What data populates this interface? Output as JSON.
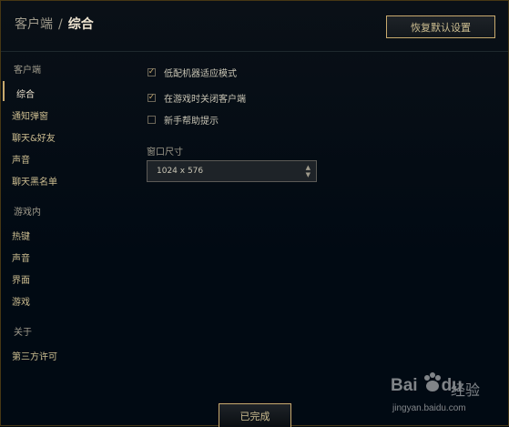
{
  "header": {
    "breadcrumb_parent": "客户端",
    "breadcrumb_sep": "/",
    "breadcrumb_current": "综合",
    "restore_button": "恢复默认设置"
  },
  "sidebar": {
    "categories": [
      {
        "label": "客户端",
        "items": [
          "综合",
          "通知弹窗",
          "聊天&好友",
          "声音",
          "聊天黑名单"
        ]
      },
      {
        "label": "游戏内",
        "items": [
          "热键",
          "声音",
          "界面",
          "游戏"
        ]
      },
      {
        "label": "关于",
        "items": [
          "第三方许可"
        ]
      }
    ],
    "active_item": "综合"
  },
  "options": [
    {
      "label": "低配机器适应模式",
      "checked": true
    },
    {
      "label": "在游戏时关闭客户端",
      "checked": true
    },
    {
      "label": "新手帮助提示",
      "checked": false
    }
  ],
  "window_size": {
    "label": "窗口尺寸",
    "value": "1024 x 576"
  },
  "footer": {
    "done_button": "已完成"
  },
  "watermark": {
    "logo_text": "Bai",
    "logo_suffix": "du",
    "brand": "经验",
    "url": "jingyan.baidu.com"
  },
  "colors": {
    "background": "#010a13",
    "gold": "#c8aa6e",
    "text": "#cdbe91"
  }
}
